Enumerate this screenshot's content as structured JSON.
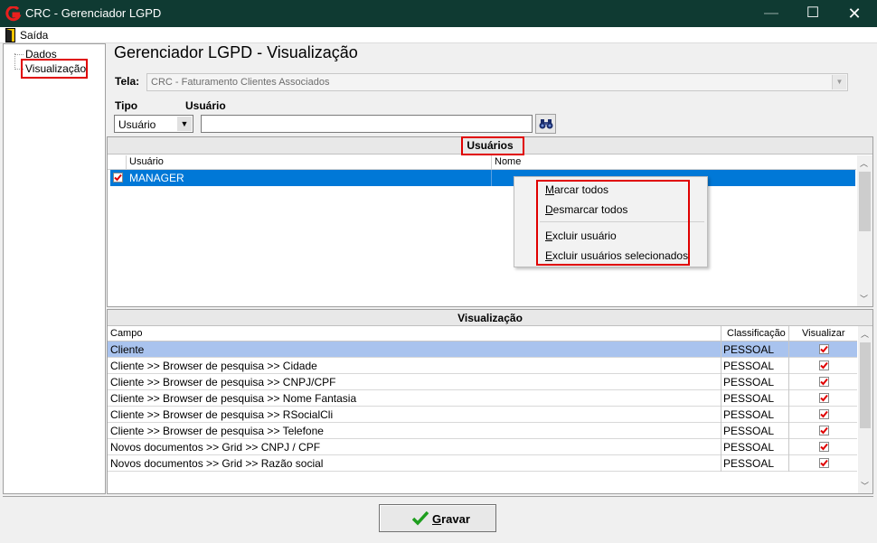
{
  "window": {
    "title": "CRC - Gerenciador LGPD",
    "minimize_glyph": "—",
    "maximize_glyph": "☐",
    "close_glyph": "✕",
    "logo_icon": "crc-logo-icon"
  },
  "menu": {
    "exit_label": "Saída",
    "exit_icon": "exit-door-icon"
  },
  "tree": {
    "items": [
      "Dados",
      "Visualização"
    ],
    "selected": "Visualização"
  },
  "header": {
    "title": "Gerenciador LGPD - Visualização",
    "tela_label": "Tela:",
    "tela_value": "CRC - Faturamento Clientes Associados",
    "tipo_label": "Tipo",
    "usuario_label": "Usuário",
    "tipo_value": "Usuário",
    "usuario_value": ""
  },
  "users_panel": {
    "title": "Usuários",
    "columns": [
      "Usuário",
      "Nome"
    ],
    "rows": [
      {
        "usuario": "MANAGER",
        "nome": "",
        "checked": true
      }
    ]
  },
  "context_menu": {
    "items": [
      {
        "accel": "M",
        "rest": "arcar todos"
      },
      {
        "accel": "D",
        "rest": "esmarcar todos"
      },
      {
        "accel": "E",
        "rest": "xcluir usuário"
      },
      {
        "accel": "E",
        "rest": "xcluir usuários selecionados"
      }
    ]
  },
  "vis_panel": {
    "title": "Visualização",
    "columns": [
      "Campo",
      "Classificação",
      "Visualizar"
    ],
    "rows": [
      {
        "campo": "Cliente",
        "classificacao": "PESSOAL",
        "visualizar": true
      },
      {
        "campo": "Cliente >> Browser de pesquisa >> Cidade",
        "classificacao": "PESSOAL",
        "visualizar": true
      },
      {
        "campo": "Cliente >> Browser de pesquisa >> CNPJ/CPF",
        "classificacao": "PESSOAL",
        "visualizar": true
      },
      {
        "campo": "Cliente >> Browser de pesquisa >> Nome Fantasia",
        "classificacao": "PESSOAL",
        "visualizar": true
      },
      {
        "campo": "Cliente >> Browser de pesquisa >> RSocialCli",
        "classificacao": "PESSOAL",
        "visualizar": true
      },
      {
        "campo": "Cliente >> Browser de pesquisa >> Telefone",
        "classificacao": "PESSOAL",
        "visualizar": true
      },
      {
        "campo": "Novos documentos >> Grid >> CNPJ / CPF",
        "classificacao": "PESSOAL",
        "visualizar": true
      },
      {
        "campo": "Novos documentos >> Grid >> Razão social",
        "classificacao": "PESSOAL",
        "visualizar": true
      }
    ]
  },
  "footer": {
    "gravar_accel": "G",
    "gravar_rest": "ravar",
    "gravar_icon": "green-check-icon"
  },
  "colors": {
    "titlebar": "#0f3a32",
    "selection": "#0078d7",
    "row_selected": "#a9c3ee",
    "highlight_box": "#e00000",
    "check_red": "#e00000"
  }
}
